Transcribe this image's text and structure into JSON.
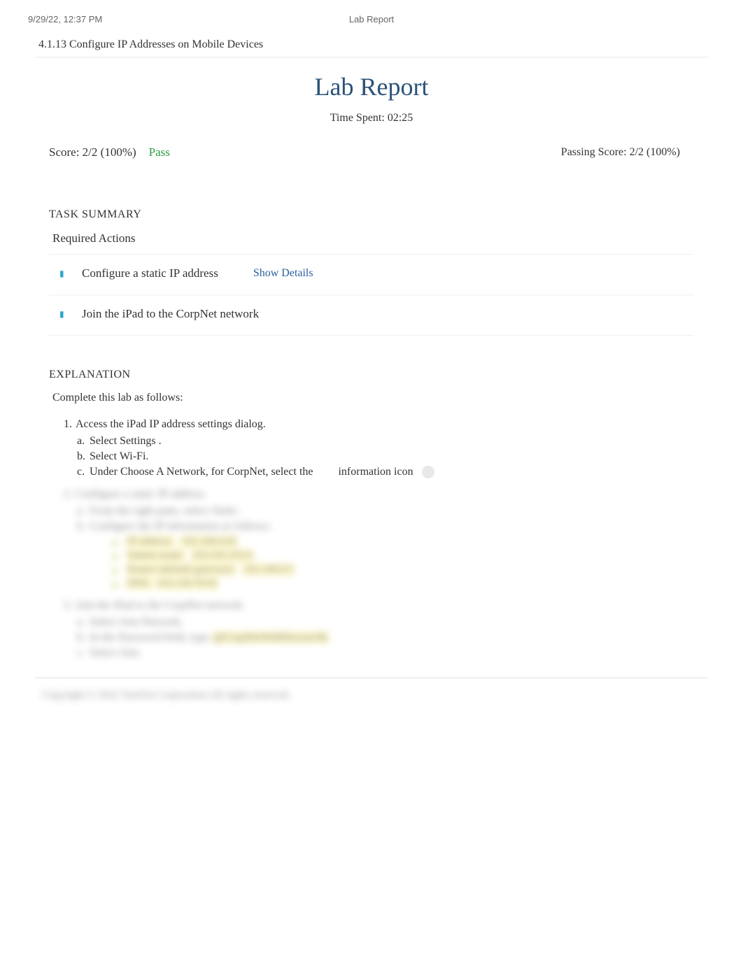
{
  "meta": {
    "timestamp": "9/29/22, 12:37 PM",
    "doc_title": "Lab Report"
  },
  "section_title": "4.1.13 Configure IP Addresses on Mobile Devices",
  "report": {
    "title": "Lab Report",
    "time_spent_label": "Time Spent: 02:25",
    "score_label": "Score: 2/2 (100%)",
    "pass_label": "Pass",
    "passing_score_label": "Passing Score: 2/2 (100%)"
  },
  "task_summary": {
    "heading": "TASK SUMMARY",
    "required_label": "Required Actions",
    "tasks": [
      {
        "label": "Configure a static IP address",
        "show_details": "Show Details"
      },
      {
        "label": "Join the iPad to the CorpNet network",
        "show_details": ""
      }
    ]
  },
  "explanation": {
    "heading": "EXPLANATION",
    "intro": "Complete this lab as follows:",
    "step1": {
      "num": "1.",
      "text": "Access the iPad IP address settings dialog.",
      "a_letter": "a.",
      "a_text_pre": "Select ",
      "a_text_hl": "Settings",
      "a_text_post": " .",
      "b_letter": "b.",
      "b_text_pre": "Select ",
      "b_text_hl": "Wi-Fi.",
      "c_letter": "c.",
      "c_text_pre": "Under Choose A Network, for CorpNet, select the ",
      "c_text_post": "information icon"
    },
    "blurred": {
      "step2_num": "2.",
      "step2_text": "Configure a static IP address.",
      "step2a_letter": "a.",
      "step2a_text": "From the right pane, select Static.",
      "step2b_letter": "b.",
      "step2b_text": "Configure the IP information as follows:",
      "bullets": [
        {
          "label": "IP address:",
          "value": "192.168.0.65"
        },
        {
          "label": "Subnet mask:",
          "value": "255.255.255.0"
        },
        {
          "label": "Router (default gateway):",
          "value": "192.168.0.5"
        },
        {
          "label": "DNS:",
          "value": "163.128.78.93"
        }
      ],
      "step3_num": "3.",
      "step3_text": "Join the iPad to the CorpNet network.",
      "step3a_letter": "a.",
      "step3a_text": "Select Join Network.",
      "step3b_letter": "b.",
      "step3b_text_pre": "In the Password field, type ",
      "step3b_text_hl": "@CorpNetWeRSecure!&",
      "step3c_letter": "c.",
      "step3c_text": "Select Join.",
      "copyright": "Copyright © 2022 TestOut Corporation All rights reserved."
    }
  }
}
